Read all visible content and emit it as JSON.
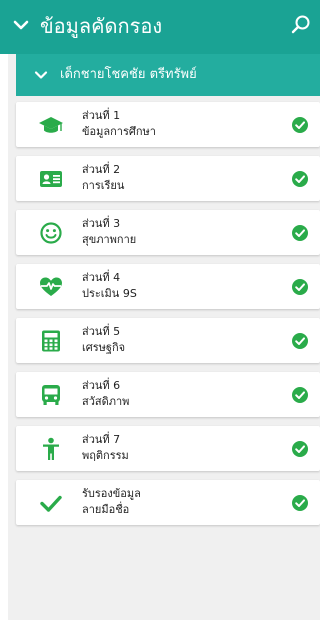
{
  "header": {
    "title": "ข้อมูลคัดกรอง",
    "chevron_icon": "chevron-down-icon",
    "search_icon": "search-icon"
  },
  "student": {
    "name": "เด็กชายโชคชัย ตรีทรัพย์",
    "chevron_icon": "chevron-down-icon"
  },
  "sections": [
    {
      "id": "part-1",
      "label": "ส่วนที่ 1",
      "title": "ข้อมูลการศึกษา",
      "icon": "graduation-cap-icon",
      "status": "complete"
    },
    {
      "id": "part-2",
      "label": "ส่วนที่ 2",
      "title": "การเรียน",
      "icon": "id-card-icon",
      "status": "complete"
    },
    {
      "id": "part-3",
      "label": "ส่วนที่ 3",
      "title": "สุขภาพกาย",
      "icon": "smiley-icon",
      "status": "complete"
    },
    {
      "id": "part-4",
      "label": "ส่วนที่ 4",
      "title": "ประเมิน 9S",
      "icon": "heartbeat-icon",
      "status": "complete"
    },
    {
      "id": "part-5",
      "label": "ส่วนที่ 5",
      "title": "เศรษฐกิจ",
      "icon": "calculator-icon",
      "status": "complete"
    },
    {
      "id": "part-6",
      "label": "ส่วนที่ 6",
      "title": "สวัสดิภาพ",
      "icon": "bus-icon",
      "status": "complete"
    },
    {
      "id": "part-7",
      "label": "ส่วนที่ 7",
      "title": "พฤติกรรม",
      "icon": "child-icon",
      "status": "complete"
    },
    {
      "id": "certify",
      "label": "รับรองข้อมูล",
      "title": "ลายมือชื่อ",
      "icon": "checkmark-icon",
      "status": "complete"
    }
  ],
  "colors": {
    "header_bg": "#1aa394",
    "subheader_bg": "#23ad9f",
    "icon_green": "#2aab4a",
    "panel_bg": "#f0f0f0"
  }
}
